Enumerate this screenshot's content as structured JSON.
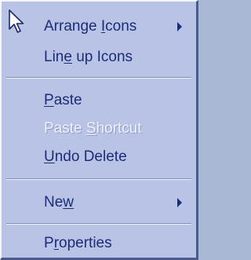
{
  "menu": {
    "items": [
      {
        "label_pre": "Arrange ",
        "mnemonic": "I",
        "label_post": "cons",
        "enabled": true,
        "submenu": true
      },
      {
        "label_pre": "Lin",
        "mnemonic": "e",
        "label_post": " up Icons",
        "enabled": true,
        "submenu": false
      },
      {
        "label_pre": "",
        "mnemonic": "P",
        "label_post": "aste",
        "enabled": true,
        "submenu": false
      },
      {
        "label_pre": "Paste ",
        "mnemonic": "S",
        "label_post": "hortcut",
        "enabled": false,
        "submenu": false
      },
      {
        "label_pre": "",
        "mnemonic": "U",
        "label_post": "ndo Delete",
        "enabled": true,
        "submenu": false
      },
      {
        "label_pre": "Ne",
        "mnemonic": "w",
        "label_post": "",
        "enabled": true,
        "submenu": true
      },
      {
        "label_pre": "P",
        "mnemonic": "r",
        "label_post": "operties",
        "enabled": true,
        "submenu": false
      }
    ]
  },
  "cursor": {
    "icon": "arrow-pointer-icon"
  }
}
